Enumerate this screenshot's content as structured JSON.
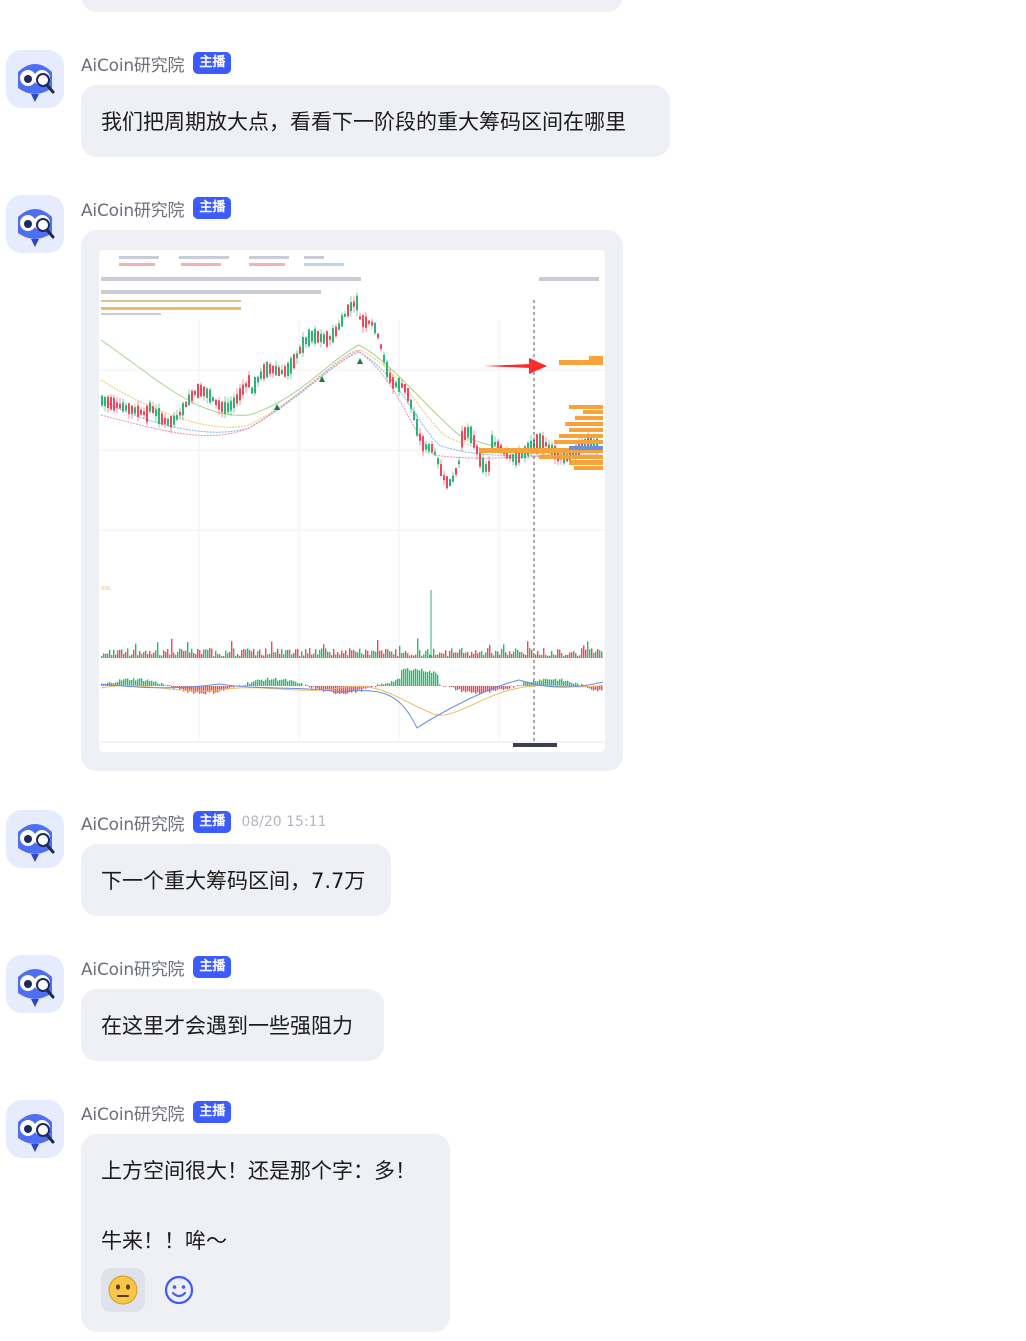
{
  "messages": [
    {
      "author": "AiCoin研究院",
      "badge": "主播",
      "text": "我们把周期放大点，看看下一阶段的重大筹码区间在哪里"
    },
    {
      "author": "AiCoin研究院",
      "badge": "主播",
      "image_alt": "BTC chart with volume profile and red arrow"
    },
    {
      "author": "AiCoin研究院",
      "badge": "主播",
      "time": "08/20 15:11",
      "text": "下一个重大筹码区间，7.7万"
    },
    {
      "author": "AiCoin研究院",
      "badge": "主播",
      "text": "在这里才会遇到一些强阻力"
    },
    {
      "author": "AiCoin研究院",
      "badge": "主播",
      "line1": "上方空间很大！还是那个字：多！",
      "line2": "牛来！！哞～"
    }
  ],
  "reactions": [
    {
      "icon": "neutral-face-emoji-icon",
      "active": true
    },
    {
      "icon": "add-reaction-smiley-icon",
      "active": false
    }
  ],
  "colors": {
    "bubble": "#eef0f6",
    "badge": "#3d5cff",
    "up": "#2bb673",
    "down": "#f0485a",
    "volume_profile": "#f7a23b",
    "arrow": "#ff2a2a"
  }
}
